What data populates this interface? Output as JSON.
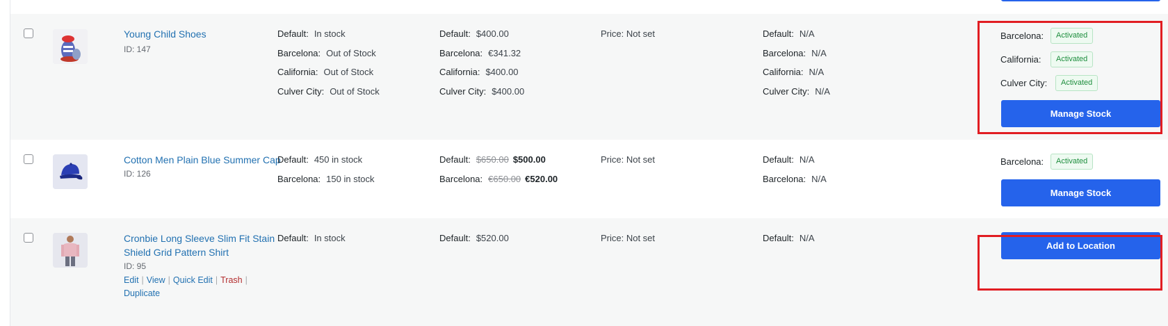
{
  "products": [
    {
      "name": "Young Child Shoes",
      "id_text": "ID: 147",
      "stock": [
        {
          "label": "Default:",
          "value": "In stock"
        },
        {
          "label": "Barcelona:",
          "value": "Out of Stock"
        },
        {
          "label": "California:",
          "value": "Out of Stock"
        },
        {
          "label": "Culver City:",
          "value": "Out of Stock"
        }
      ],
      "prices": [
        {
          "label": "Default:",
          "value": "$400.00"
        },
        {
          "label": "Barcelona:",
          "value": "€341.32"
        },
        {
          "label": "California:",
          "value": "$400.00"
        },
        {
          "label": "Culver City:",
          "value": "$400.00"
        }
      ],
      "price_note": "Price: Not set",
      "extra": [
        {
          "label": "Default:",
          "value": "N/A"
        },
        {
          "label": "Barcelona:",
          "value": "N/A"
        },
        {
          "label": "California:",
          "value": "N/A"
        },
        {
          "label": "Culver City:",
          "value": "N/A"
        }
      ],
      "locations": [
        {
          "label": "Barcelona:",
          "status": "Activated"
        },
        {
          "label": "California:",
          "status": "Activated"
        },
        {
          "label": "Culver City:",
          "status": "Activated"
        }
      ],
      "button": "Manage Stock"
    },
    {
      "name": "Cotton Men Plain Blue Summer Cap",
      "id_text": "ID: 126",
      "stock": [
        {
          "label": "Default:",
          "value": "450 in stock"
        },
        {
          "label": "Barcelona:",
          "value": "150 in stock"
        }
      ],
      "prices": [
        {
          "label": "Default:",
          "old": "$650.00",
          "new": "$500.00"
        },
        {
          "label": "Barcelona:",
          "old": "€650.00",
          "new": "€520.00"
        }
      ],
      "price_note": "Price: Not set",
      "extra": [
        {
          "label": "Default:",
          "value": "N/A"
        },
        {
          "label": "Barcelona:",
          "value": "N/A"
        }
      ],
      "locations": [
        {
          "label": "Barcelona:",
          "status": "Activated"
        }
      ],
      "button": "Manage Stock"
    },
    {
      "name_line1": "Cronbie Long Sleeve Slim Fit Stain",
      "name_line2": "Shield Grid Pattern Shirt",
      "id_text": "ID: 95",
      "row_actions": {
        "edit": "Edit",
        "view": "View",
        "quick_edit": "Quick Edit",
        "trash": "Trash",
        "sep": "|",
        "duplicate": "Duplicate"
      },
      "stock": [
        {
          "label": "Default:",
          "value": "In stock"
        }
      ],
      "prices": [
        {
          "label": "Default:",
          "value": "$520.00"
        }
      ],
      "price_note": "Price: Not set",
      "extra": [
        {
          "label": "Default:",
          "value": "N/A"
        }
      ],
      "button": "Add to Location"
    }
  ],
  "colors": {
    "accent_button": "#2563eb",
    "link": "#2271b1",
    "highlight_box": "#e11d22",
    "badge_text": "#1e8e3e",
    "trash": "#b32d2e"
  },
  "icons": [
    "shoe-image",
    "cap-image",
    "shirt-image"
  ]
}
